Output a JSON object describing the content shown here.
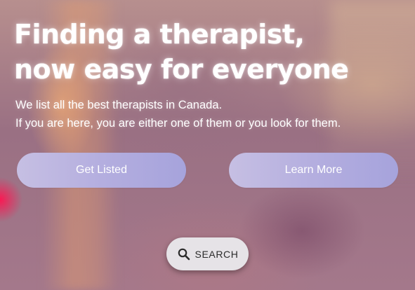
{
  "hero": {
    "headline_line1": "Finding a therapist,",
    "headline_line2": "now easy for everyone",
    "subtext_line1": "We list all the best therapists in Canada.",
    "subtext_line2": "If you are here, you are either one of them or you look for them."
  },
  "buttons": {
    "get_listed_label": "Get Listed",
    "learn_more_label": "Learn More",
    "search_label": "SEARCH",
    "search_icon": "search-icon"
  },
  "colors": {
    "cta_gradient_start": "#c6bfe3",
    "cta_gradient_end": "#a6a3dc",
    "search_button_bg": "#e6e3e7",
    "text": "#ffffff"
  }
}
